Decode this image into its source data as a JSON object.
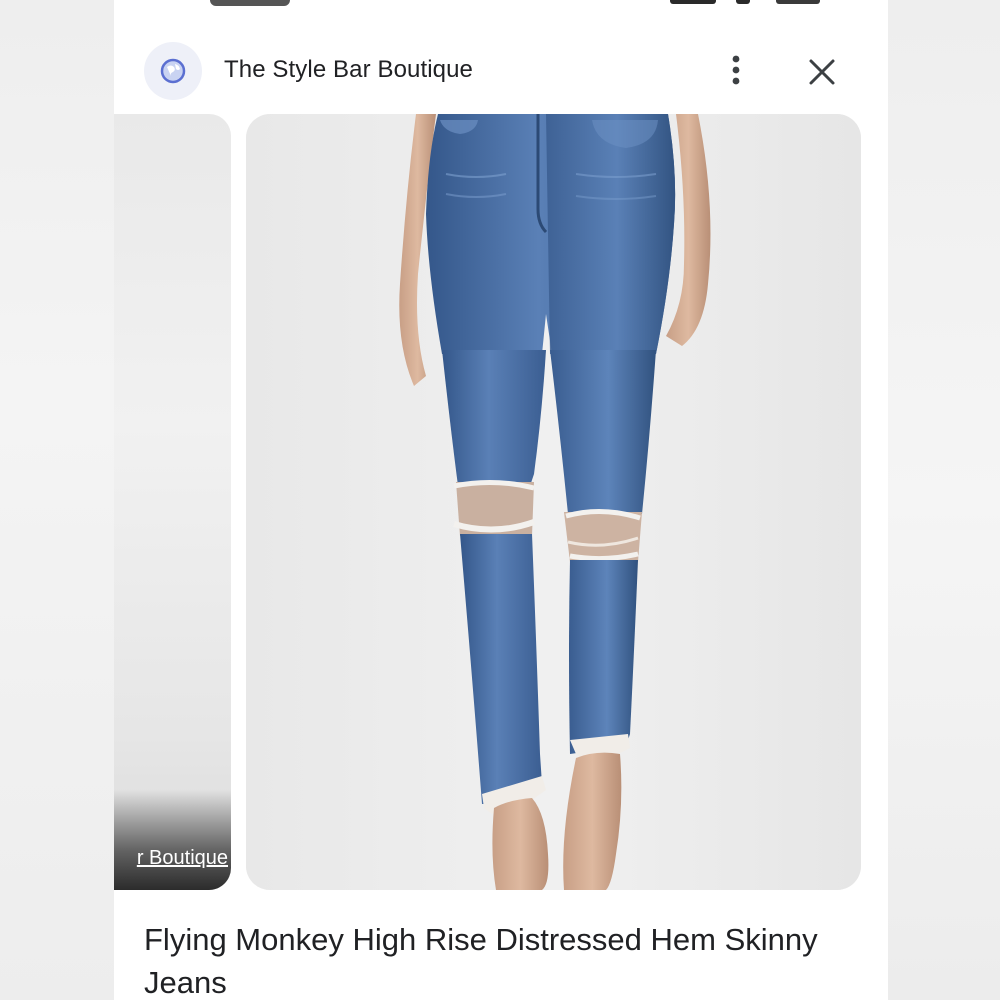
{
  "header": {
    "site_name": "The Style Bar Boutique",
    "site_icon": "globe-icon",
    "more_icon": "more-vertical-icon",
    "close_icon": "close-icon"
  },
  "carousel": {
    "previous_card": {
      "source_label": "r Boutique"
    },
    "current_card": {
      "image": "product-photo-distressed-skinny-jeans"
    }
  },
  "product": {
    "title": "Flying Monkey High Rise Distressed Hem Skinny Jeans"
  },
  "colors": {
    "text_primary": "#202124",
    "surface": "#ffffff",
    "denim": "#4a6fa3"
  }
}
